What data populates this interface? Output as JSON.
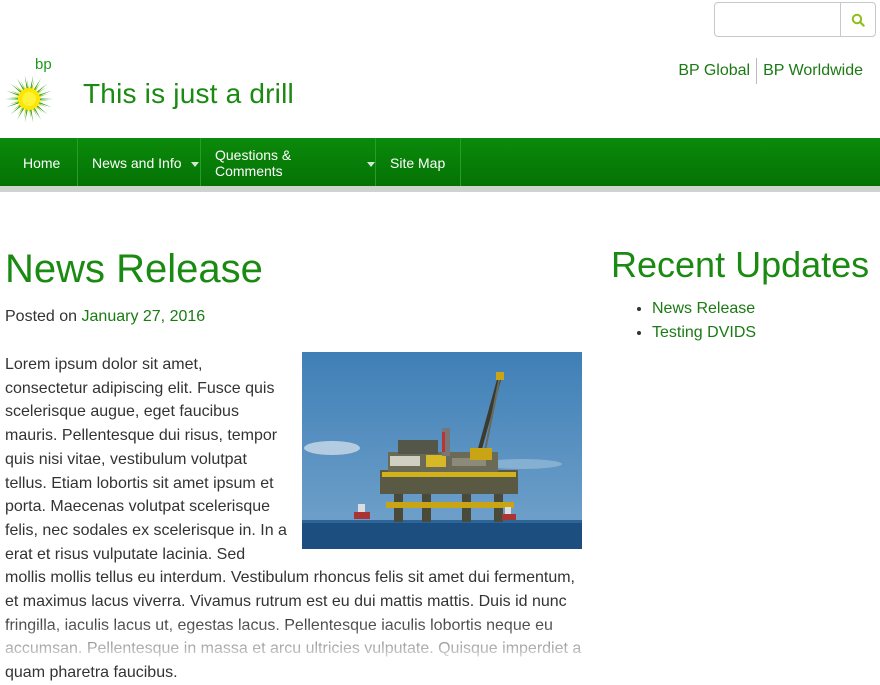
{
  "header": {
    "search": {
      "placeholder": "",
      "value": "",
      "icon": "search-icon"
    },
    "logo": {
      "text": "bp",
      "icon": "bp-helios-logo"
    },
    "site_title": "This is just a drill",
    "links": [
      "BP Global",
      "BP Worldwide"
    ]
  },
  "nav": {
    "items": [
      {
        "label": "Home",
        "has_dropdown": false
      },
      {
        "label": "News and Info",
        "has_dropdown": true
      },
      {
        "label": "Questions & Comments",
        "has_dropdown": true
      },
      {
        "label": "Site Map",
        "has_dropdown": false
      }
    ]
  },
  "post": {
    "title": "News Release",
    "posted_on_label": "Posted on",
    "date": "January 27, 2016",
    "image_subject": "offshore-oil-platform",
    "body": "Lorem ipsum dolor sit amet, consectetur adipiscing elit. Fusce quis scelerisque augue, eget faucibus mauris. Pellentesque dui risus, tempor quis nisi vitae, vestibulum volutpat tellus. Etiam lobortis sit amet ipsum et porta. Maecenas volutpat scelerisque felis, nec sodales ex scelerisque in. In a erat et risus vulputate lacinia. Sed mollis mollis tellus eu interdum. Vestibulum rhoncus felis sit amet dui fermentum, et maximus lacus viverra. Vivamus rutrum est eu dui mattis mattis. Duis id nunc fringilla, iaculis lacus ut, egestas lacus. Pellentesque iaculis lobortis neque eu accumsan. Pellentesque in massa et arcu ultricies vulputate. Quisque imperdiet a quam pharetra faucibus."
  },
  "sidebar": {
    "title": "Recent Updates",
    "items": [
      "News Release",
      "Testing DVIDS"
    ]
  },
  "colors": {
    "brand_green": "#1b8a12",
    "nav_green": "#078007",
    "link_green": "#1b7a14"
  }
}
